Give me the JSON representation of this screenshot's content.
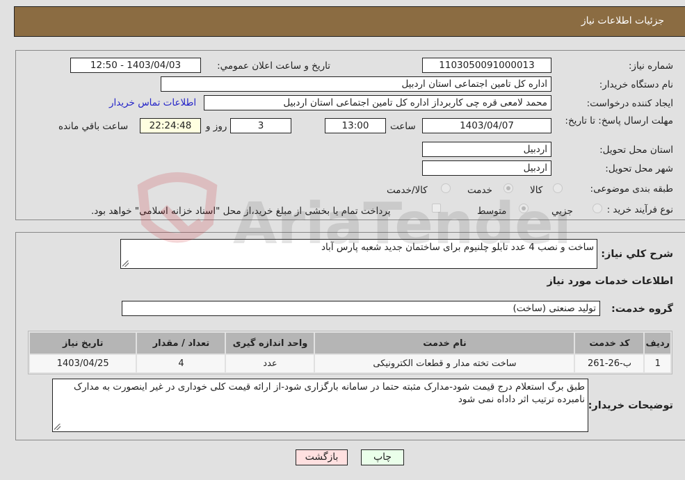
{
  "header": {
    "title": "جزئيات اطلاعات نياز"
  },
  "fields": {
    "need_number": {
      "label": "شماره نياز:",
      "value": "1103050091000013"
    },
    "announce_datetime": {
      "label": "تاريخ و ساعت اعلان عمومي:",
      "value": "1403/04/03 - 12:50"
    },
    "buyer_org": {
      "label": "نام دستگاه خريدار:",
      "value": "اداره کل تامین اجتماعی استان اردبیل"
    },
    "requester": {
      "label": "ايجاد کننده درخواست:",
      "value": "محمد لامعی قره چی کاربرداز اداره کل تامین اجتماعی استان اردبیل"
    },
    "buyer_contact_link": "اطلاعات تماس خريدار",
    "deadline": {
      "label": "مهلت ارسال پاسخ: تا تاريخ:",
      "date": "1403/04/07",
      "time_label": "ساعت",
      "time": "13:00",
      "days": "3",
      "days_label": "روز و",
      "remaining": "22:24:48",
      "remaining_label": "ساعت باقي مانده"
    },
    "delivery_province": {
      "label": "استان محل تحويل:",
      "value": "اردبیل"
    },
    "delivery_city": {
      "label": "شهر محل تحويل:",
      "value": "اردبیل"
    },
    "category": {
      "label": "طبقه بندی موضوعی:",
      "options": [
        {
          "label": "کالا",
          "checked": false
        },
        {
          "label": "خدمت",
          "checked": true
        },
        {
          "label": "کالا/خدمت",
          "checked": false
        }
      ]
    },
    "purchase_type": {
      "label": "نوع فرآيند خريد :",
      "options": [
        {
          "label": "جزيي",
          "checked": false
        },
        {
          "label": "متوسط",
          "checked": true
        }
      ],
      "treasury_checkbox_label": "پرداخت تمام يا بخشی از مبلغ خريد،از محل \"اسناد خزانه اسلامی\" خواهد بود.",
      "treasury_checked": false
    }
  },
  "description": {
    "label": "شرح کلي نياز:",
    "value": "ساخت و نصب 4 عدد تابلو چلنیوم برای ساختمان جدید شعبه پارس آباد"
  },
  "services_section_title": "اطلاعات خدمات مورد نياز",
  "service_group": {
    "label": "گروه خدمت:",
    "value": "تولید صنعتی (ساخت)"
  },
  "services_table": {
    "columns": [
      "رديف",
      "کد خدمت",
      "نام خدمت",
      "واحد اندازه گيری",
      "تعداد / مقدار",
      "تاريخ نياز"
    ],
    "rows": [
      [
        "1",
        "ب-26-261",
        "ساخت تخته مدار و قطعات الکترونیکی",
        "عدد",
        "4",
        "1403/04/25"
      ]
    ]
  },
  "buyer_notes": {
    "label": "توضيحات خريدار:",
    "value": "طبق برگ استعلام درج قیمت شود-مدارک مثبته حتما در سامانه بارگزاری شود-از ارائه قیمت کلی خوداری در غیر اینصورت به مدارک نامبرده ترتیب اثر داداه نمی شود"
  },
  "buttons": {
    "print": "چاپ",
    "back": "بازگشت"
  },
  "watermark": {
    "text": "AriaTender.neT"
  },
  "colors": {
    "header_bg": "#8b6c42",
    "print_bg": "#eaffea",
    "back_bg": "#ffe0e0",
    "link": "#2323c8"
  }
}
